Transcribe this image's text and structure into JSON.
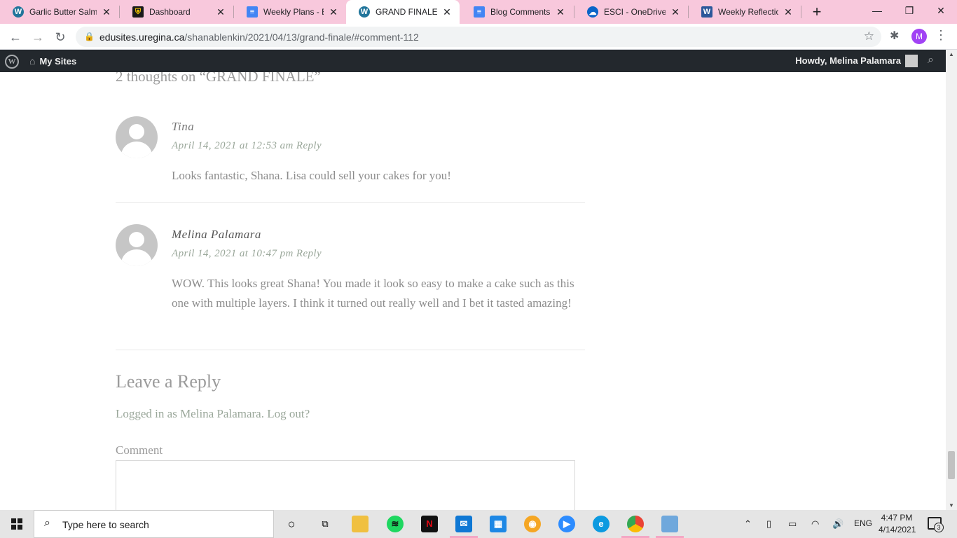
{
  "browser": {
    "tabs": [
      {
        "title": "Garlic Butter Salmo",
        "icon": "wordpress-icon"
      },
      {
        "title": "Dashboard",
        "icon": "shield-icon"
      },
      {
        "title": "Weekly Plans - EDT",
        "icon": "google-docs-icon"
      },
      {
        "title": "GRAND FINALE – S",
        "icon": "wordpress-icon",
        "active": true
      },
      {
        "title": "Blog Comments - G",
        "icon": "google-docs-icon"
      },
      {
        "title": "ESCI - OneDrive",
        "icon": "onedrive-icon"
      },
      {
        "title": "Weekly Reflections",
        "icon": "word-icon"
      }
    ],
    "url_host": "edusites.uregina.ca",
    "url_path": "/shanablenkin/2021/04/13/grand-finale/#comment-112",
    "profile_initial": "M"
  },
  "adminbar": {
    "my_sites": "My Sites",
    "howdy": "Howdy, Melina Palamara"
  },
  "comments": {
    "title": "2 thoughts on “GRAND FINALE”",
    "items": [
      {
        "author": "Tina",
        "date": "April 14, 2021 at 12:53 am",
        "reply": "Reply",
        "text": "Looks fantastic, Shana. Lisa could sell your cakes for you!"
      },
      {
        "author": "Melina Palamara",
        "date": "April 14, 2021 at 10:47 pm",
        "reply": "Reply",
        "text": "WOW. This looks great Shana! You made it look so easy to make a cake such as this one with multiple layers. I think it turned out really well and I bet it tasted amazing!"
      }
    ]
  },
  "reply_form": {
    "title": "Leave a Reply",
    "logged_in_prefix": "Logged in as Melina Palamara.",
    "logout": "Log out?",
    "comment_label": "Comment"
  },
  "taskbar": {
    "search_placeholder": "Type here to search",
    "language": "ENG",
    "time": "4:47 PM",
    "date": "4/14/2021",
    "notification_count": "3"
  },
  "colors": {
    "tab_strip": "#f8c8dc",
    "admin_bar": "#23282d",
    "meta_green": "#9aa79a"
  }
}
